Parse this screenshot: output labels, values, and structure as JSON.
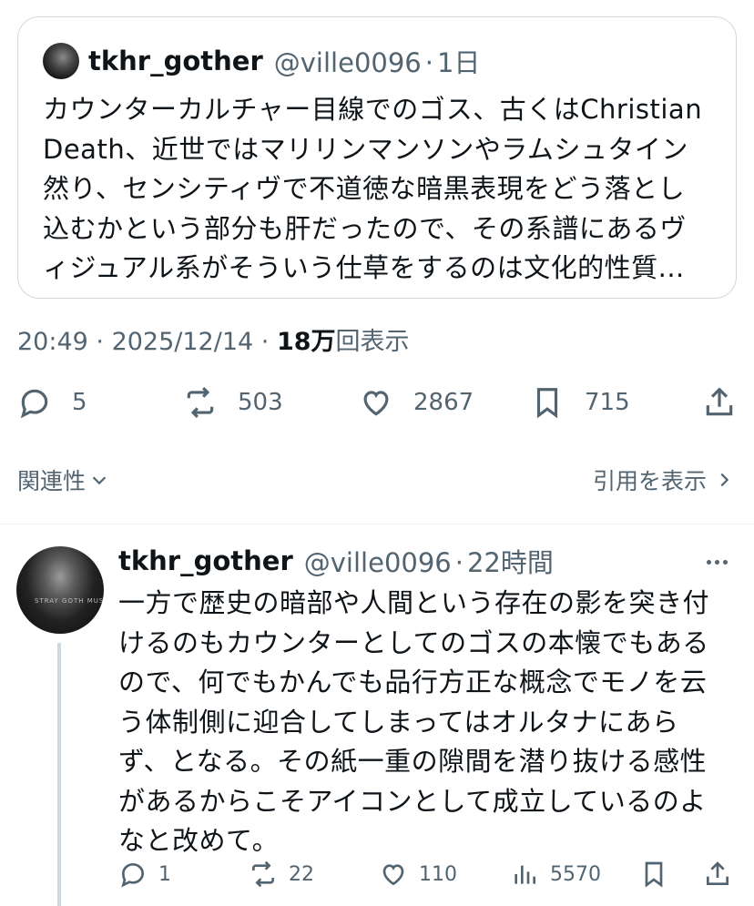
{
  "quote": {
    "author_name": "tkhr_gother",
    "author_handle": "@ville0096",
    "time_sep": "·",
    "time": "1日",
    "text_lines": [
      "カウンターカルチャー目線でのゴス、古くはChristian",
      "Death、近世ではマリリンマンソンやラムシュタイン",
      "然り、センシティヴで不道徳な暗黒表現をどう落とし",
      "込むかという部分も肝だったので、その系譜にあるヴ",
      "ィジュアル系がそういう仕草をするのは文化的性質..."
    ]
  },
  "meta": {
    "time": "20:49",
    "sep1": " · ",
    "date": "2025/12/14",
    "sep2": " · ",
    "views_count": "18万",
    "views_label": "回表示"
  },
  "actions": {
    "replies": "5",
    "reposts": "503",
    "likes": "2867",
    "bookmarks": "715"
  },
  "related_label": "関連性",
  "quotes_label": "引用を表示",
  "reply": {
    "author_name": "tkhr_gother",
    "author_handle": "@ville0096",
    "time_sep": "·",
    "time": "22時間",
    "text_lines": [
      "一方で歴史の暗部や人間という存在の影を突き付",
      "けるのもカウンターとしてのゴスの本懐でもある",
      "ので、何でもかんでも品行方正な概念でモノを云",
      "う体制側に迎合してしまってはオルタナにあら",
      "ず、となる。その紙一重の隙間を潜り抜ける感性",
      "があるからこそアイコンとして成立しているのよ",
      "なと改めて。"
    ],
    "replies": "1",
    "reposts": "22",
    "likes": "110",
    "views": "5570"
  }
}
